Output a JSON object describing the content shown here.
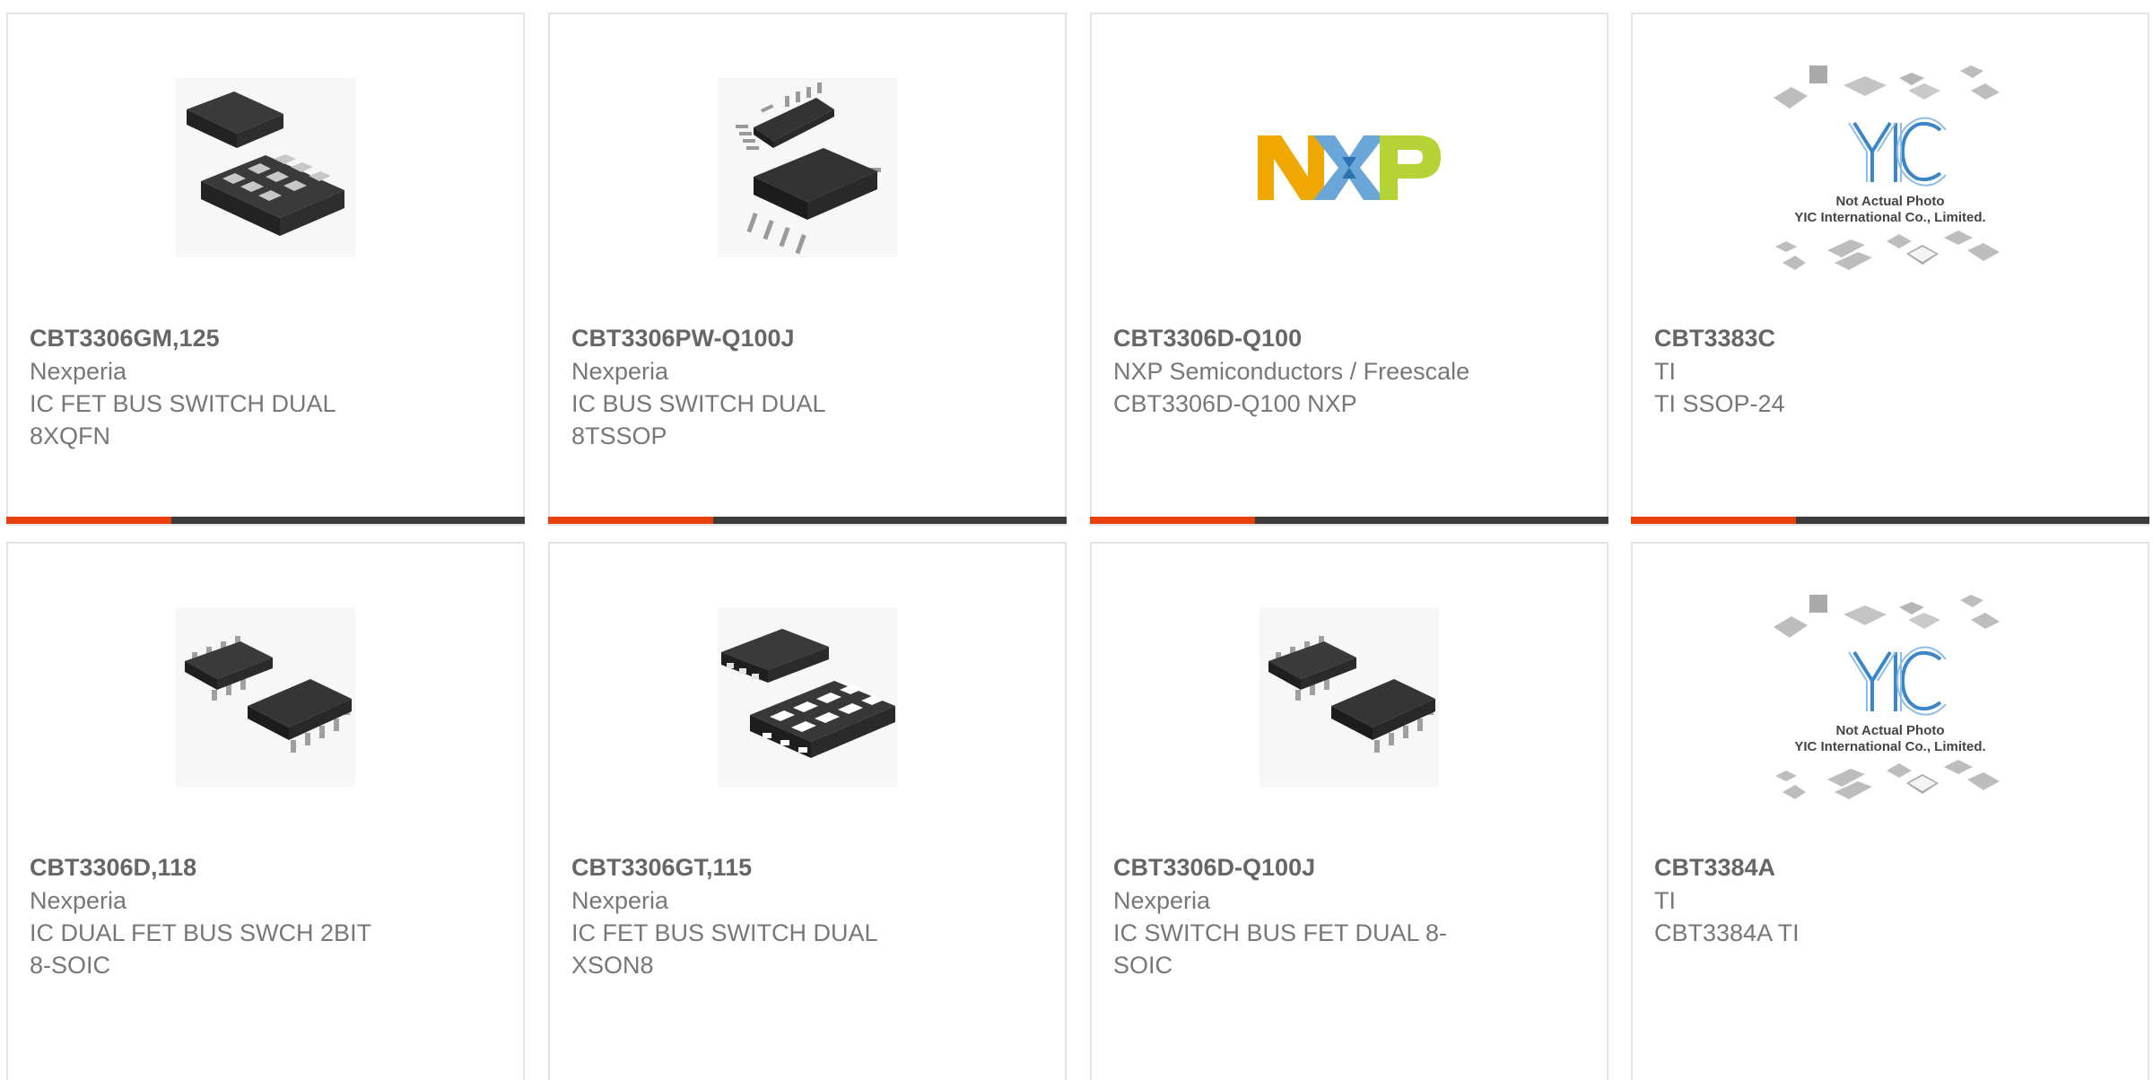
{
  "products": [
    {
      "part": "CBT3306GM,125",
      "manufacturer": "Nexperia",
      "description": "IC FET BUS SWITCH DUAL 8XQFN",
      "image": "xqfn-package-image"
    },
    {
      "part": "CBT3306PW-Q100J",
      "manufacturer": "Nexperia",
      "description": "IC BUS SWITCH DUAL 8TSSOP",
      "image": "tssop-package-image"
    },
    {
      "part": "CBT3306D-Q100",
      "manufacturer": "NXP Semiconductors / Freescale",
      "description": "CBT3306D-Q100 NXP",
      "image": "nxp-logo-image"
    },
    {
      "part": "CBT3383C",
      "manufacturer": "TI",
      "description": "TI SSOP-24",
      "image": "yic-placeholder-image"
    },
    {
      "part": "CBT3306D,118",
      "manufacturer": "Nexperia",
      "description": "IC DUAL FET BUS SWCH 2BIT 8-SOIC",
      "image": "soic-package-image"
    },
    {
      "part": "CBT3306GT,115",
      "manufacturer": "Nexperia",
      "description": "IC FET BUS SWITCH DUAL XSON8",
      "image": "xson-package-image"
    },
    {
      "part": "CBT3306D-Q100J",
      "manufacturer": "Nexperia",
      "description": "IC SWITCH BUS FET DUAL 8-SOIC",
      "image": "soic-package-image"
    },
    {
      "part": "CBT3384A",
      "manufacturer": "TI",
      "description": "CBT3384A TI",
      "image": "yic-placeholder-image"
    }
  ],
  "placeholder": {
    "logo": "YIC",
    "line1": "Not Actual Photo",
    "line2": "YIC International Co., Limited."
  },
  "nxp_logo": {
    "letters": "NXP"
  },
  "colors": {
    "accent": "#e8400c",
    "bar": "#3b3b3b",
    "border": "#e3e3e3"
  }
}
